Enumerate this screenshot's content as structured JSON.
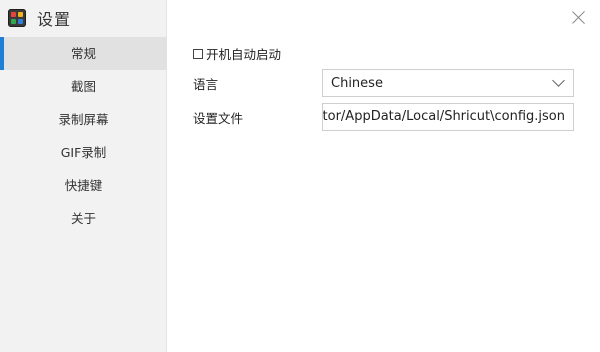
{
  "app": {
    "title": "设置",
    "icon": "app-logo-icon"
  },
  "sidebar": {
    "items": [
      {
        "label": "常规",
        "active": true
      },
      {
        "label": "截图",
        "active": false
      },
      {
        "label": "录制屏幕",
        "active": false
      },
      {
        "label": "GIF录制",
        "active": false
      },
      {
        "label": "快捷键",
        "active": false
      },
      {
        "label": "关于",
        "active": false
      }
    ]
  },
  "general": {
    "autostart_label": "开机自动启动",
    "autostart_checked": false,
    "language_label": "语言",
    "language_value": "Chinese",
    "config_label": "设置文件",
    "config_path_visible": "strator/AppData/Local/Shricut\\config.json"
  },
  "colors": {
    "accent": "#1f7fd6",
    "sidebar_bg": "#f2f2f2",
    "active_item_bg": "#e1e1e1"
  }
}
